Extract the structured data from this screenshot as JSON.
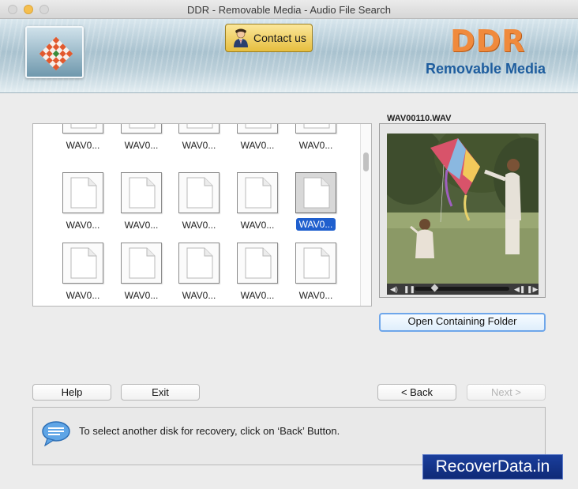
{
  "window": {
    "title": "DDR - Removable Media - Audio File Search"
  },
  "banner": {
    "contact_label": "Contact us",
    "brand_title": "DDR",
    "brand_subtitle": "Removable Media"
  },
  "files": {
    "items": [
      {
        "label": "WAV0...",
        "selected": false
      },
      {
        "label": "WAV0...",
        "selected": false
      },
      {
        "label": "WAV0...",
        "selected": false
      },
      {
        "label": "WAV0...",
        "selected": false
      },
      {
        "label": "WAV0...",
        "selected": false
      },
      {
        "label": "WAV0...",
        "selected": false
      },
      {
        "label": "WAV0...",
        "selected": false
      },
      {
        "label": "WAV0...",
        "selected": false
      },
      {
        "label": "WAV0...",
        "selected": false
      },
      {
        "label": "WAV0...",
        "selected": true
      },
      {
        "label": "WAV0...",
        "selected": false
      },
      {
        "label": "WAV0...",
        "selected": false
      },
      {
        "label": "WAV0...",
        "selected": false
      },
      {
        "label": "WAV0...",
        "selected": false
      },
      {
        "label": "WAV0...",
        "selected": false
      }
    ]
  },
  "preview": {
    "filename": "WAV00110.WAV",
    "open_folder_label": "Open Containing Folder"
  },
  "buttons": {
    "help": "Help",
    "exit": "Exit",
    "back": "< Back",
    "next": "Next >"
  },
  "status": {
    "message": "To select another disk for recovery, click on ‘Back’ Button."
  },
  "watermark": "RecoverData.in",
  "colors": {
    "accent": "#1f5fce",
    "brand_orange": "#f08a3c",
    "brand_blue": "#1e5d9e",
    "contact_gold": "#e6be3f"
  }
}
